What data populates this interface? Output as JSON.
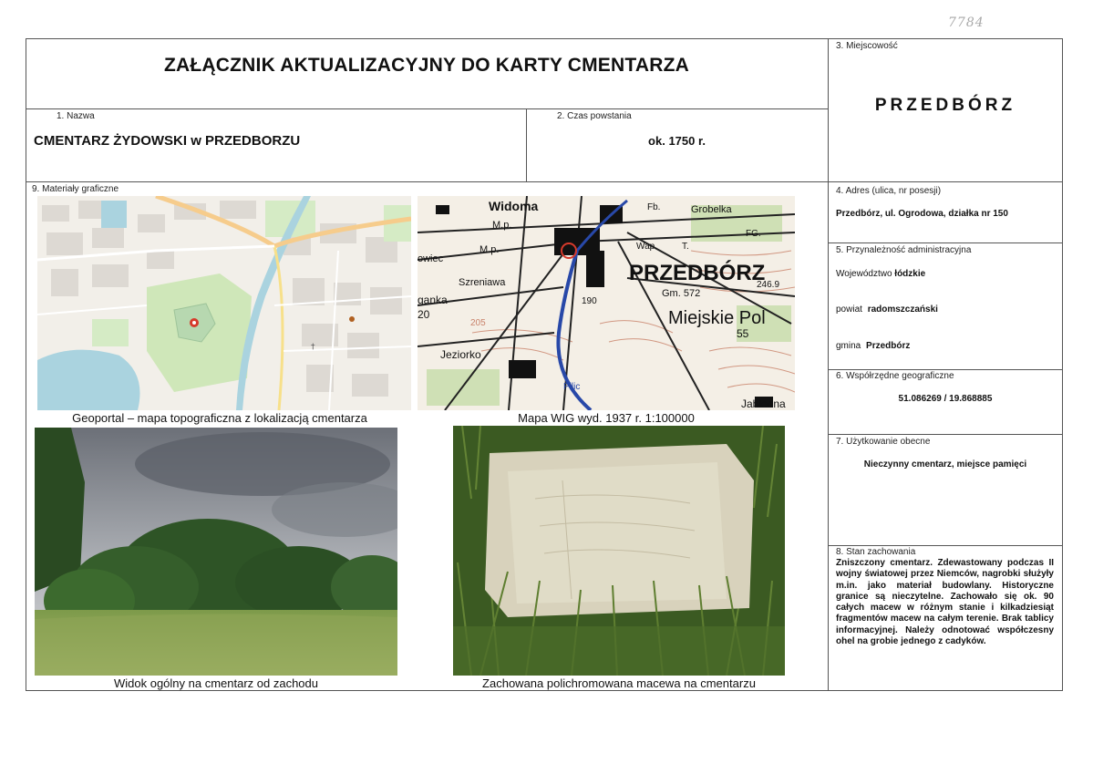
{
  "archive_mark": "7784",
  "title": "ZAŁĄCZNIK AKTUALIZACYJNY DO KARTY CMENTARZA",
  "fields": {
    "name": {
      "label": "1.   Nazwa",
      "value": "CMENTARZ ŻYDOWSKI  w  PRZEDBORZU"
    },
    "founding": {
      "label": "2.   Czas powstania",
      "value": "ok. 1750 r."
    },
    "locality": {
      "label": "3. Miejscowość",
      "value": "PRZEDBÓRZ"
    },
    "address": {
      "label": "4. Adres (ulica, nr posesji)",
      "value": "Przedbórz, ul. Ogrodowa, działka nr 150"
    },
    "admin": {
      "label": "5. Przynależność administracyjna",
      "voivodeship_prefix": "Województwo",
      "voivodeship": "łódzkie",
      "county_prefix": "powiat",
      "county": "radomszczański",
      "commune_prefix": "gmina",
      "commune": "Przedbórz"
    },
    "coords": {
      "label": "6. Współrzędne geograficzne",
      "value": "51.086269 / 19.868885"
    },
    "usage": {
      "label": "7. Użytkowanie obecne",
      "value": "Nieczynny cmentarz, miejsce pamięci"
    },
    "condition": {
      "label": "8. Stan zachowania",
      "value": "Zniszczony cmentarz. Zdewastowany podczas II wojny światowej przez Niemców, nagrobki służyły m.in. jako materiał budowlany. Historyczne granice są nieczytelne. Zachowało się ok. 90 całych macew w różnym stanie i kilkadziesiąt fragmentów macew na całym terenie. Brak tablicy informacyjnej. Należy odnotować współczesny ohel na grobie jednego z cadyków."
    },
    "graphics": {
      "label": "9. Materiały graficzne"
    }
  },
  "captions": {
    "geoportal": "Geoportal – mapa topograficzna z lokalizacją cmentarza",
    "wig": "Mapa WIG wyd. 1937 r.  1:100000",
    "view": "Widok ogólny  na cmentarz od zachodu",
    "matzevah": "Zachowana polichromowana macewa na cmentarzu"
  },
  "map_labels": {
    "wig_town": "PRZEDBÓRZ",
    "wig_widoma": "Widoma",
    "wig_grobelka": "Grobelka",
    "wig_miejskie": "Miejskie Pol",
    "wig_jeziorko": "Jeziorko",
    "wig_jablonna": "Jabłonna",
    "wig_sreniawa": "Szreniawa",
    "wig_gm": "Gm. 572",
    "wig_mp1": "M.p.",
    "wig_mp2": "M.p.",
    "wig_fb": "Fb.",
    "wig_wap": "Wap.",
    "wig_ganka": "ganka",
    "wig_owiec": "owiec",
    "wig_190": "190",
    "wig_205": "205",
    "wig_55": "55",
    "wig_20": "20",
    "wig_2469": "246.9",
    "wig_t": "T.",
    "wig_fg": "FG.",
    "wig_pilic": "Pilic"
  },
  "colors": {
    "border": "#555555",
    "map_marker": "#d63a2b",
    "map_water": "#aad3df",
    "map_green": "#c8e6b4"
  }
}
